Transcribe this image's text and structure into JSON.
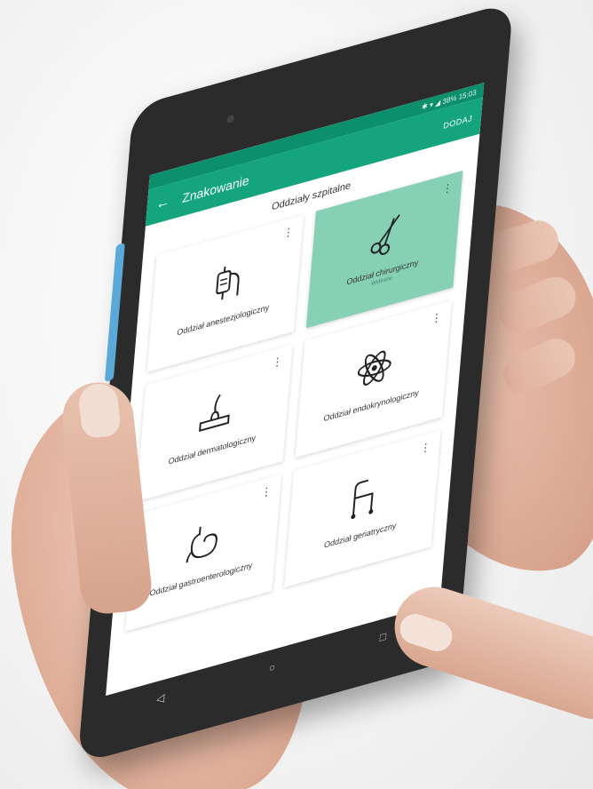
{
  "status_bar": {
    "text": "✱ ▾ ◢ 38% 15:03"
  },
  "app_bar": {
    "title": "Znakowanie",
    "action": "DODAJ",
    "back_icon": "arrow-left-icon"
  },
  "section_title": "Oddziały szpitalne",
  "tiles": [
    {
      "label": "Oddział anestezjologiczny",
      "icon": "iv-drip-icon",
      "active": false
    },
    {
      "label": "Oddział chirurgiczny",
      "sub": "Wybrano",
      "icon": "scissors-icon",
      "active": true
    },
    {
      "label": "Oddział dermatologiczny",
      "icon": "hair-follicle-icon",
      "active": false
    },
    {
      "label": "Oddział endokrynologiczny",
      "icon": "atom-icon",
      "active": false
    },
    {
      "label": "Oddział gastroenterologiczny",
      "icon": "stomach-icon",
      "active": false
    },
    {
      "label": "Oddział geriatryczny",
      "icon": "walker-icon",
      "active": false
    }
  ],
  "nav": {
    "back": "◁",
    "home": "○",
    "recent": "□"
  },
  "colors": {
    "primary": "#15a57e",
    "status": "#0b8f6d",
    "active_tile": "#86d0b5"
  }
}
